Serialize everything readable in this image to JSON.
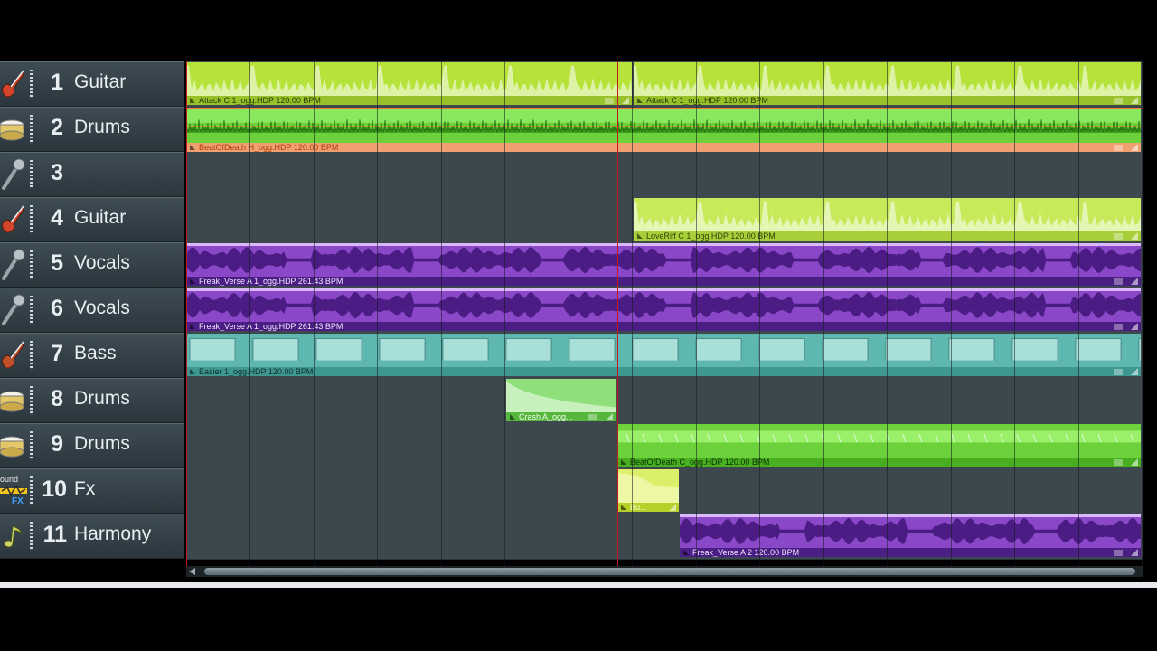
{
  "tracks": [
    {
      "num": "1",
      "name": "Guitar",
      "icon": "guitar-icon"
    },
    {
      "num": "2",
      "name": "Drums",
      "icon": "drum-icon"
    },
    {
      "num": "3",
      "name": "",
      "icon": "microphone-icon"
    },
    {
      "num": "4",
      "name": "Guitar",
      "icon": "guitar-icon"
    },
    {
      "num": "5",
      "name": "Vocals",
      "icon": "microphone-icon"
    },
    {
      "num": "6",
      "name": "Vocals",
      "icon": "microphone-icon"
    },
    {
      "num": "7",
      "name": "Bass",
      "icon": "bass-icon"
    },
    {
      "num": "8",
      "name": "Drums",
      "icon": "drum-icon"
    },
    {
      "num": "9",
      "name": "Drums",
      "icon": "drum-icon"
    },
    {
      "num": "10",
      "name": "Fx",
      "icon": "sound-fx-icon",
      "icon_text_top": "ound",
      "icon_text_bottom": "FX"
    },
    {
      "num": "11",
      "name": "Harmony",
      "icon": "note-icon"
    }
  ],
  "clips": {
    "t1a": {
      "label": "Attack C 1_ogg.HDP  120.00 BPM"
    },
    "t1b": {
      "label": "Attack C 1_ogg.HDP  120.00 BPM"
    },
    "t2a": {
      "label": "BeatOfDeath H_ogg.HDP  120.00 BPM"
    },
    "t4a": {
      "label": "LoveRiff C 1_ogg.HDP  120.00 BPM"
    },
    "t5a": {
      "label": "Freak_Verse A 1_ogg.HDP  261.43 BPM"
    },
    "t6a": {
      "label": "Freak_Verse A 1_ogg.HDP  261.43 BPM"
    },
    "t7a": {
      "label": "Easier 1_ogg.HDP  120.00 BPM"
    },
    "t8a": {
      "label": "Crash A_ogg..."
    },
    "t9a": {
      "label": "BeatOfDeath C_ogg.HDP  120.00 BPM"
    },
    "t10a": {
      "label": "Bu..."
    },
    "t11a": {
      "label": "Freak_Verse A 2  120.00 BPM"
    }
  },
  "colors": {
    "guitar": "#b5e33a",
    "drums_orange": "#f0a070",
    "drums_green": "#6cd13a",
    "vocals": "#8a48c8",
    "bass": "#5fb8b0",
    "playhead": "#c8181c"
  }
}
